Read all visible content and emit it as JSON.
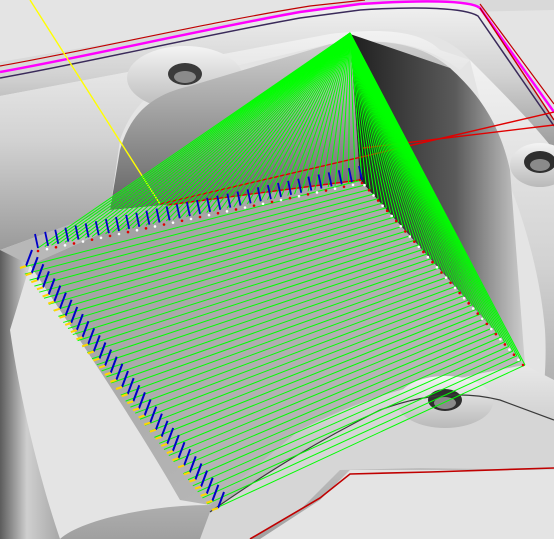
{
  "viewport": {
    "background": "#dcdcdc",
    "colors": {
      "part_light": "#e6e6e6",
      "part_mid": "#bdbdbd",
      "part_dark": "#6e6e6e",
      "part_shadow": "#2b2b2b",
      "pocket_floor": "#a8a8a8",
      "edge_outline": "#c00000",
      "flange_edge": "#ff00ff",
      "toolpath_green": "#00ff00",
      "tool_axis_blue": "#0000c8",
      "tool_tip_yellow": "#ffd400",
      "workplane_red": "#e00000",
      "guide_yellow": "#ffff00"
    }
  }
}
